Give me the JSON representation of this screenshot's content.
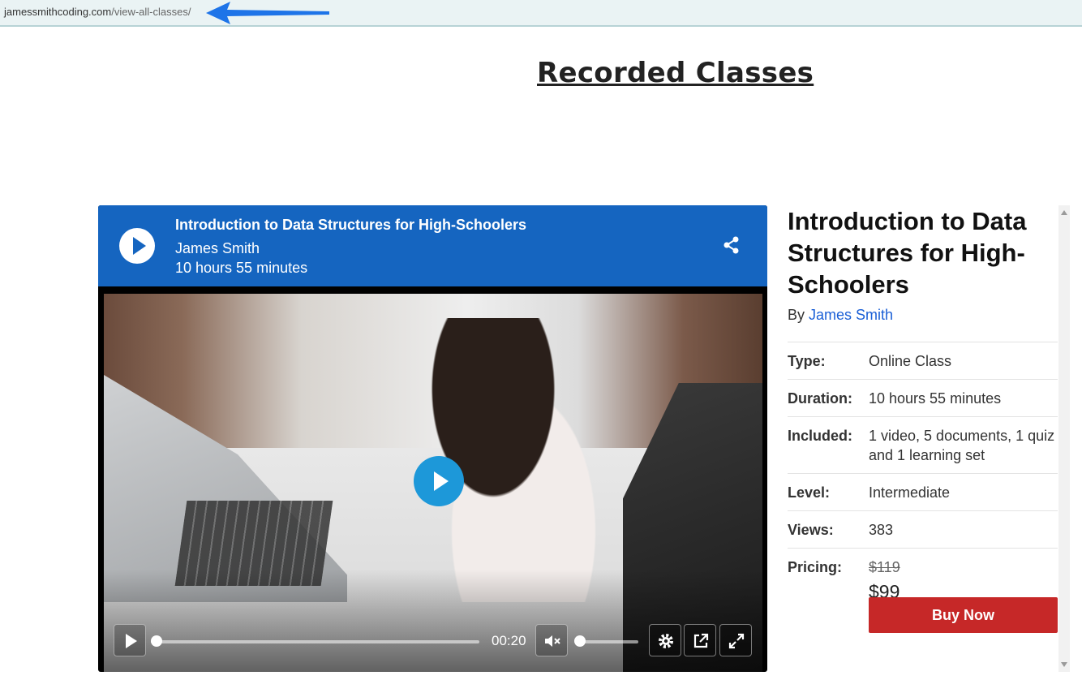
{
  "browser": {
    "url_domain": "jamessmithcoding.com",
    "url_path": "/view-all-classes/",
    "annotation": "arrow pointing at url",
    "annotation_color": "#1e74e8"
  },
  "page": {
    "title": "Recorded Classes"
  },
  "player": {
    "title": "Introduction to Data Structures for High-Schoolers",
    "author": "James Smith",
    "duration": "10 hours 55 minutes",
    "header_color": "#1565c0",
    "time": "00:20",
    "progress_fraction": 0.0,
    "volume_fraction": 0.0,
    "icons": [
      "play-icon",
      "share-icon",
      "mute-icon",
      "settings-icon",
      "popout-icon",
      "fullscreen-icon"
    ]
  },
  "info": {
    "title": "Introduction to Data Structures for High-Schoolers",
    "by_label": "By",
    "author": "James Smith",
    "rows": [
      {
        "key": "Type:",
        "value": "Online Class"
      },
      {
        "key": "Duration:",
        "value": "10 hours 55 minutes"
      },
      {
        "key": "Included:",
        "value": "1 video, 5 documents, 1 quiz and 1 learning set"
      },
      {
        "key": "Level:",
        "value": "Intermediate"
      },
      {
        "key": "Views:",
        "value": "383"
      }
    ],
    "pricing_label": "Pricing:",
    "old_price": "$119",
    "new_price": "$99",
    "buy_label": "Buy Now",
    "buy_color": "#c62828"
  }
}
